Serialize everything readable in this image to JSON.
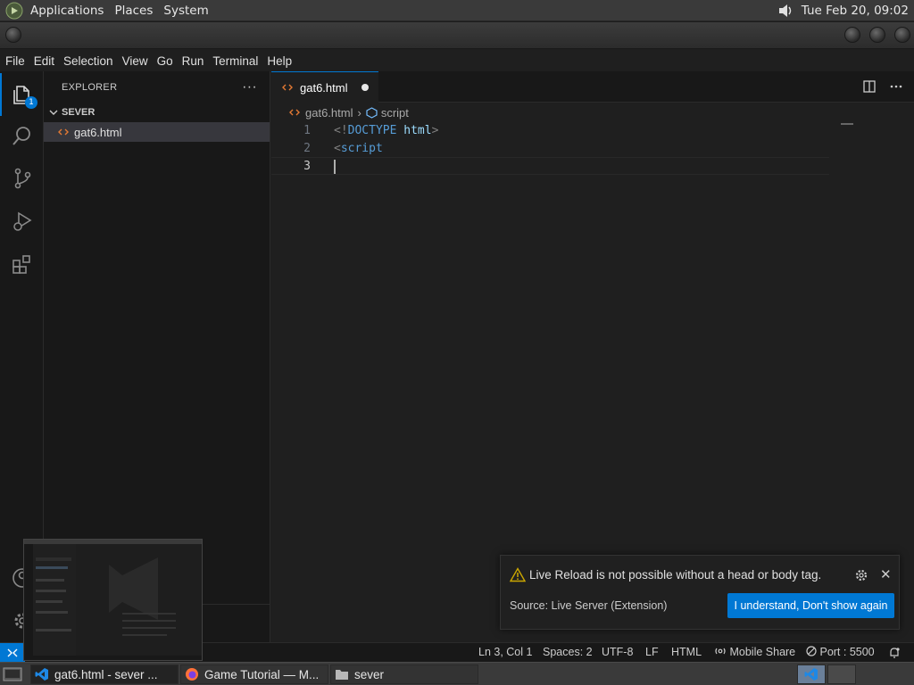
{
  "top_panel": {
    "menus": [
      "Applications",
      "Places",
      "System"
    ],
    "clock": "Tue Feb 20, 09:02"
  },
  "menubar": [
    "File",
    "Edit",
    "Selection",
    "View",
    "Go",
    "Run",
    "Terminal",
    "Help"
  ],
  "activity_bar": {
    "explorer_badge": "1"
  },
  "sidebar": {
    "title": "EXPLORER",
    "more": "···",
    "folder": "SEVER",
    "files": [
      "gat6.html"
    ]
  },
  "editor": {
    "tab_label": "gat6.html",
    "breadcrumb": {
      "file": "gat6.html",
      "symbol": "script"
    },
    "line_numbers": [
      "1",
      "2",
      "3"
    ],
    "lines": {
      "l1_open": "<!",
      "l1_kw": "DOCTYPE",
      "l1_attr": " html",
      "l1_close": ">",
      "l2_open": "<",
      "l2_kw": "script"
    }
  },
  "statusbar": {
    "position": "Ln 3, Col 1",
    "spaces": "Spaces: 2",
    "encoding": "UTF-8",
    "eol": "LF",
    "language": "HTML",
    "mobile_share": "Mobile Share",
    "port": "Port : 5500"
  },
  "notification": {
    "message": "Live Reload is not possible without a head or body tag.",
    "source": "Source: Live Server (Extension)",
    "button": "I understand, Don't show again"
  },
  "taskbar": {
    "items": [
      "gat6.html - sever ...",
      "Game Tutorial — M...",
      "sever"
    ]
  },
  "colors": {
    "accent": "#0078d4",
    "editor_bg": "#1f1f1f",
    "sidebar_bg": "#181818"
  }
}
